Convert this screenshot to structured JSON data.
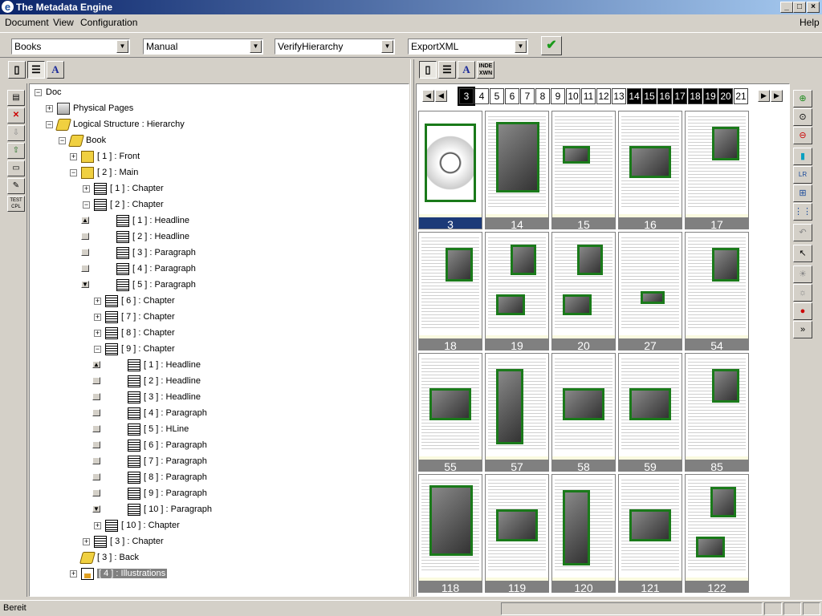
{
  "window": {
    "title": "The Metadata Engine",
    "min": "_",
    "max": "□",
    "close": "×"
  },
  "menu": [
    "Document",
    "View",
    "Configuration"
  ],
  "menu_help": "Help",
  "toolbar": {
    "combos": [
      "Books",
      "Manual",
      "VerifyHierarchy",
      "ExportXML"
    ],
    "ok_label": "✔"
  },
  "view_tabs": {
    "left": [
      "page-view",
      "structure-view",
      "text-view"
    ],
    "right": [
      "page-view",
      "structure-view",
      "text-view",
      "index-view"
    ],
    "index_label": "INDE XWN",
    "text_label": "A"
  },
  "left_tools": [
    "properties",
    "delete",
    "move-down",
    "move-up",
    "list",
    "edit",
    "test"
  ],
  "left_tools_text": "TEST CPL",
  "tree": [
    {
      "label": "Doc",
      "depth": 0,
      "exp": "-",
      "icon": "none"
    },
    {
      "label": "Physical Pages",
      "depth": 1,
      "exp": "+",
      "icon": "stack"
    },
    {
      "label": "Logical Structure : Hierarchy",
      "depth": 1,
      "exp": "-",
      "icon": "book"
    },
    {
      "label": "Book",
      "depth": 2,
      "exp": "-",
      "icon": "book"
    },
    {
      "label": "[ 1 ] : Front",
      "depth": 3,
      "exp": "+",
      "icon": "struct"
    },
    {
      "label": "[ 2 ] : Main",
      "depth": 3,
      "exp": "-",
      "icon": "struct"
    },
    {
      "label": "[ 1 ] : Chapter",
      "depth": 4,
      "exp": "+",
      "icon": "page"
    },
    {
      "label": "[ 2 ] : Chapter",
      "depth": 4,
      "exp": "-",
      "icon": "page"
    },
    {
      "label": "[ 1 ] : Headline",
      "depth": 5,
      "exp": "",
      "icon": "page"
    },
    {
      "label": "[ 2 ] : Headline",
      "depth": 5,
      "exp": "",
      "icon": "page"
    },
    {
      "label": "[ 3 ] : Paragraph",
      "depth": 5,
      "exp": "",
      "icon": "page"
    },
    {
      "label": "[ 4 ] : Paragraph",
      "depth": 5,
      "exp": "",
      "icon": "page"
    },
    {
      "label": "[ 5 ] : Paragraph",
      "depth": 5,
      "exp": "",
      "icon": "page"
    },
    {
      "label": "[ 6 ] : Chapter",
      "depth": 4.99,
      "exp": "+",
      "icon": "page"
    },
    {
      "label": "[ 7 ] : Chapter",
      "depth": 4.99,
      "exp": "+",
      "icon": "page"
    },
    {
      "label": "[ 8 ] : Chapter",
      "depth": 4.99,
      "exp": "+",
      "icon": "page"
    },
    {
      "label": "[ 9 ] : Chapter",
      "depth": 4.99,
      "exp": "-",
      "icon": "page"
    },
    {
      "label": "[ 1 ] : Headline",
      "depth": 6,
      "exp": "",
      "icon": "page"
    },
    {
      "label": "[ 2 ] : Headline",
      "depth": 6,
      "exp": "",
      "icon": "page"
    },
    {
      "label": "[ 3 ] : Headline",
      "depth": 6,
      "exp": "",
      "icon": "page"
    },
    {
      "label": "[ 4 ] : Paragraph",
      "depth": 6,
      "exp": "",
      "icon": "page"
    },
    {
      "label": "[ 5 ] : HLine",
      "depth": 6,
      "exp": "",
      "icon": "page"
    },
    {
      "label": "[ 6 ] : Paragraph",
      "depth": 6,
      "exp": "",
      "icon": "page"
    },
    {
      "label": "[ 7 ] : Paragraph",
      "depth": 6,
      "exp": "",
      "icon": "page"
    },
    {
      "label": "[ 8 ] : Paragraph",
      "depth": 6,
      "exp": "",
      "icon": "page"
    },
    {
      "label": "[ 9 ] : Paragraph",
      "depth": 6,
      "exp": "",
      "icon": "page"
    },
    {
      "label": "[ 10 ] : Paragraph",
      "depth": 6,
      "exp": "",
      "icon": "page"
    },
    {
      "label": "[ 10 ] : Chapter",
      "depth": 4.99,
      "exp": "+",
      "icon": "page"
    },
    {
      "label": "[ 3 ] : Chapter",
      "depth": 4,
      "exp": "+",
      "icon": "page"
    },
    {
      "label": "[ 3 ] : Back",
      "depth": 3,
      "exp": "",
      "icon": "book"
    },
    {
      "label": "[ 4 ] : Illustrations",
      "depth": 3,
      "exp": "+",
      "icon": "img",
      "selected": true
    }
  ],
  "page_strip": [
    {
      "n": "3",
      "dark": true,
      "cur": true
    },
    {
      "n": "4"
    },
    {
      "n": "5"
    },
    {
      "n": "6"
    },
    {
      "n": "7"
    },
    {
      "n": "8"
    },
    {
      "n": "9"
    },
    {
      "n": "10"
    },
    {
      "n": "11"
    },
    {
      "n": "12"
    },
    {
      "n": "13"
    },
    {
      "n": "14",
      "dark": true
    },
    {
      "n": "15",
      "dark": true
    },
    {
      "n": "16",
      "dark": true
    },
    {
      "n": "17",
      "dark": true
    },
    {
      "n": "18",
      "dark": true
    },
    {
      "n": "19",
      "dark": true
    },
    {
      "n": "20",
      "dark": true
    },
    {
      "n": "21"
    }
  ],
  "thumbnails": [
    {
      "n": "3",
      "active": true,
      "kind": "cover"
    },
    {
      "n": "14",
      "kind": "fullpic"
    },
    {
      "n": "15",
      "kind": "smallpic"
    },
    {
      "n": "16",
      "kind": "midpic"
    },
    {
      "n": "17",
      "kind": "portrait"
    },
    {
      "n": "18",
      "kind": "portrait"
    },
    {
      "n": "19",
      "kind": "twopic"
    },
    {
      "n": "20",
      "kind": "twopic"
    },
    {
      "n": "27",
      "kind": "tiny"
    },
    {
      "n": "54",
      "kind": "portrait"
    },
    {
      "n": "55",
      "kind": "midpic"
    },
    {
      "n": "57",
      "kind": "tall"
    },
    {
      "n": "58",
      "kind": "midpic"
    },
    {
      "n": "59",
      "kind": "midpic"
    },
    {
      "n": "85",
      "kind": "portrait"
    },
    {
      "n": "118",
      "kind": "fullpic"
    },
    {
      "n": "119",
      "kind": "midpic"
    },
    {
      "n": "120",
      "kind": "tall"
    },
    {
      "n": "121",
      "kind": "midpic"
    },
    {
      "n": "122",
      "kind": "twopic"
    }
  ],
  "right_tools": [
    "zoom-in",
    "zoom-reset",
    "zoom-out",
    "single-page",
    "two-page",
    "four-page",
    "grid-page",
    "undo",
    "pointer",
    "brightness-up",
    "brightness-down",
    "color",
    "more"
  ],
  "status": {
    "text": "Bereit"
  }
}
